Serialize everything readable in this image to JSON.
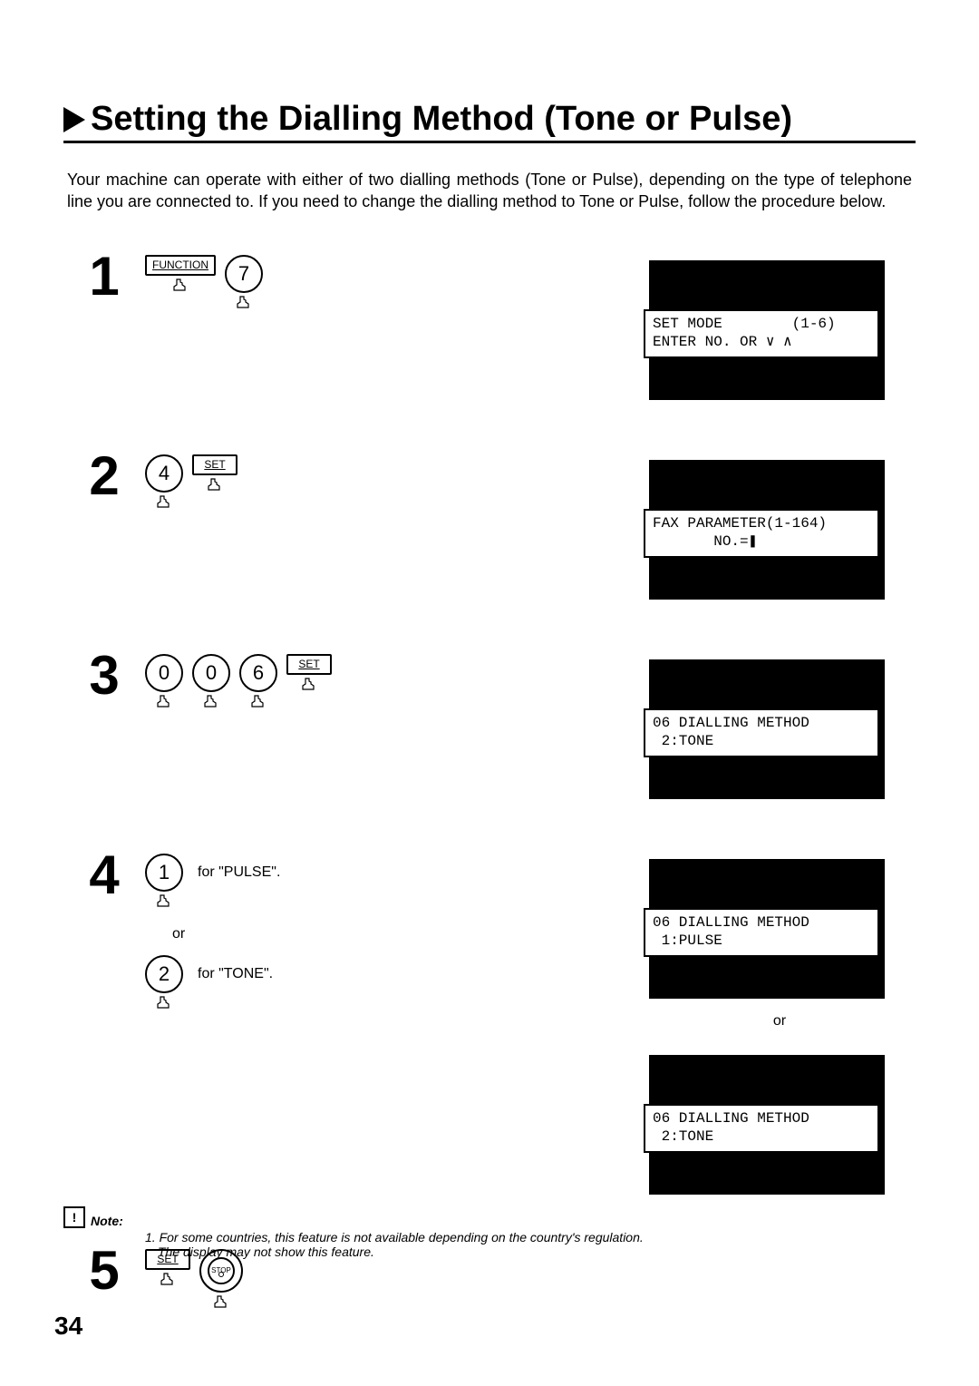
{
  "title": "Setting the Dialling Method (Tone or Pulse)",
  "intro": "Your machine can operate with either of two dialling methods (Tone or Pulse), depending on the type of telephone line you are connected to.  If you need to change the dialling method to Tone or Pulse, follow the procedure below.",
  "labels": {
    "function": "FUNCTION",
    "set": "SET",
    "stop": "STOP",
    "or": "or",
    "for_pulse": "for \"PULSE\".",
    "for_tone": "for \"TONE\"."
  },
  "keys": {
    "k0": "0",
    "k1": "1",
    "k2": "2",
    "k4": "4",
    "k6": "6",
    "k7": "7"
  },
  "steps": [
    {
      "num": "1",
      "display": [
        "SET MODE        (1-6)",
        "ENTER NO. OR ∨ ∧"
      ]
    },
    {
      "num": "2",
      "display": [
        "FAX PARAMETER(1-164)",
        "       NO.=❚"
      ]
    },
    {
      "num": "3",
      "display": [
        "06 DIALLING METHOD",
        " 2:TONE"
      ]
    },
    {
      "num": "4",
      "display_a": [
        "06 DIALLING METHOD",
        " 1:PULSE"
      ],
      "display_b": [
        "06 DIALLING METHOD",
        " 2:TONE"
      ]
    },
    {
      "num": "5"
    }
  ],
  "note": {
    "label": "Note:",
    "lines": [
      "1. For some countries, this feature is not available depending on the country's regulation.",
      "The display may not show this feature."
    ]
  },
  "page_number": "34"
}
